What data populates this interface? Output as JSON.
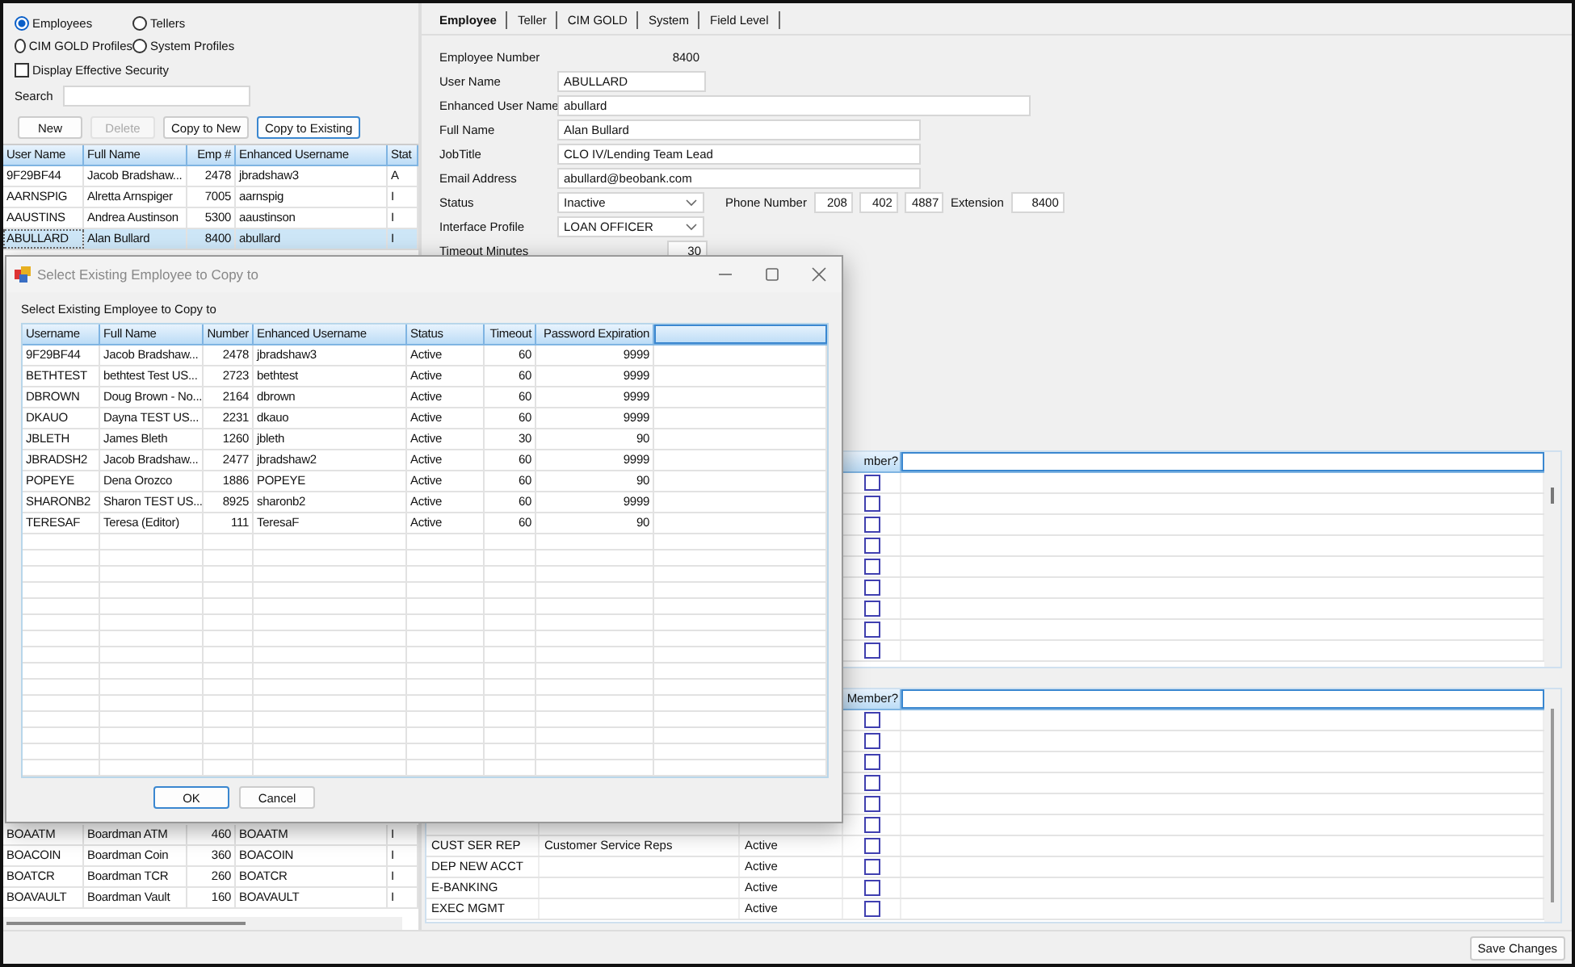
{
  "filter": {
    "options": [
      {
        "label": "Employees",
        "selected": true
      },
      {
        "label": "Tellers",
        "selected": false
      },
      {
        "label": "CIM GOLD Profiles",
        "selected": false
      },
      {
        "label": "System Profiles",
        "selected": false
      }
    ],
    "effective_security": {
      "label": "Display Effective Security",
      "checked": false
    }
  },
  "search": {
    "label": "Search"
  },
  "buttons": [
    {
      "label": "New",
      "disabled": false,
      "focused": false
    },
    {
      "label": "Delete",
      "disabled": true,
      "focused": false
    },
    {
      "label": "Copy to New",
      "disabled": false,
      "focused": false
    },
    {
      "label": "Copy to Existing",
      "disabled": false,
      "focused": true
    }
  ],
  "employee_table": {
    "columns": [
      {
        "label": "User Name",
        "numeric": false
      },
      {
        "label": "Full Name",
        "numeric": false
      },
      {
        "label": "Emp #",
        "numeric": true
      },
      {
        "label": "Enhanced Username",
        "numeric": false
      },
      {
        "label": "Stat",
        "numeric": false
      }
    ],
    "rows_top": [
      {
        "cells": [
          "9F29BF44",
          "Jacob Bradshaw...",
          "2478",
          "jbradshaw3",
          "A"
        ],
        "selected": false
      },
      {
        "cells": [
          "AARNSPIG",
          "Alretta Arnspiger",
          "7005",
          "aarnspig",
          "I"
        ],
        "selected": false
      },
      {
        "cells": [
          "AAUSTINS",
          "Andrea Austinson",
          "5300",
          "aaustinson",
          "I"
        ],
        "selected": false
      },
      {
        "cells": [
          "ABULLARD",
          "Alan Bullard",
          "8400",
          "abullard",
          "I"
        ],
        "selected": true
      }
    ],
    "rows_bottom": [
      {
        "cells": [
          "BOAATM",
          "Boardman ATM",
          "460",
          "BOAATM",
          "I"
        ],
        "selected": false
      },
      {
        "cells": [
          "BOACOIN",
          "Boardman Coin",
          "360",
          "BOACOIN",
          "I"
        ],
        "selected": false
      },
      {
        "cells": [
          "BOATCR",
          "Boardman TCR",
          "260",
          "BOATCR",
          "I"
        ],
        "selected": false
      },
      {
        "cells": [
          "BOAVAULT",
          "Boardman Vault",
          "160",
          "BOAVAULT",
          "I"
        ],
        "selected": false
      }
    ]
  },
  "tabs": [
    {
      "label": "Employee",
      "selected": true
    },
    {
      "label": "Teller",
      "selected": false
    },
    {
      "label": "CIM GOLD",
      "selected": false
    },
    {
      "label": "System",
      "selected": false
    },
    {
      "label": "Field Level",
      "selected": false
    }
  ],
  "form": {
    "employee_number": {
      "label": "Employee Number",
      "value": "8400"
    },
    "user_name": {
      "label": "User Name",
      "value": "ABULLARD"
    },
    "enhanced_user_name": {
      "label": "Enhanced User Name",
      "value": "abullard"
    },
    "full_name": {
      "label": "Full Name",
      "value": "Alan Bullard"
    },
    "job_title": {
      "label": "JobTitle",
      "value": "CLO IV/Lending Team Lead"
    },
    "email": {
      "label": "Email Address",
      "value": "abullard@beobank.com"
    },
    "status": {
      "label": "Status",
      "value": "Inactive"
    },
    "phone": {
      "label": "Phone Number",
      "parts": [
        "208",
        "402",
        "4887"
      ]
    },
    "extension": {
      "label": "Extension",
      "value": "8400"
    },
    "interface_profile": {
      "label": "Interface Profile",
      "value": "LOAN OFFICER"
    },
    "timeout": {
      "label": "Timeout Minutes",
      "value": "30"
    }
  },
  "group_grid_1": {
    "header": "mber?",
    "rows": [
      {
        "member": false
      },
      {
        "member": false
      },
      {
        "member": false
      },
      {
        "member": false
      },
      {
        "member": false
      },
      {
        "member": false
      },
      {
        "member": false
      },
      {
        "member": false
      },
      {
        "member": false
      }
    ]
  },
  "group_grid_2": {
    "header": "Member?",
    "rows": [
      {
        "member": false
      },
      {
        "member": false
      },
      {
        "member": false
      },
      {
        "member": false
      },
      {
        "member": false
      },
      {
        "member": false
      },
      {
        "member": false,
        "cells": [
          "CUST SER REP",
          "Customer Service Reps",
          "Active"
        ]
      },
      {
        "member": false,
        "cells": [
          "DEP NEW ACCT",
          "",
          "Active"
        ]
      },
      {
        "member": false,
        "cells": [
          "E-BANKING",
          "",
          "Active"
        ]
      },
      {
        "member": false,
        "cells": [
          "EXEC MGMT",
          "",
          "Active"
        ]
      }
    ]
  },
  "save_button": {
    "label": "Save Changes"
  },
  "dialog": {
    "title": "Select Existing Employee to Copy to",
    "label": "Select Existing Employee to Copy to",
    "columns": [
      {
        "label": "Username",
        "numeric": false
      },
      {
        "label": "Full Name",
        "numeric": false
      },
      {
        "label": "Number",
        "numeric": true
      },
      {
        "label": "Enhanced Username",
        "numeric": false
      },
      {
        "label": "Status",
        "numeric": false
      },
      {
        "label": "Timeout",
        "numeric": true
      },
      {
        "label": "Password Expiration",
        "numeric": true
      }
    ],
    "rows": [
      [
        "9F29BF44",
        "Jacob Bradshaw...",
        "2478",
        "jbradshaw3",
        "Active",
        "60",
        "9999"
      ],
      [
        "BETHTEST",
        "bethtest Test US...",
        "2723",
        "bethtest",
        "Active",
        "60",
        "9999"
      ],
      [
        "DBROWN",
        "Doug Brown - No...",
        "2164",
        "dbrown",
        "Active",
        "60",
        "9999"
      ],
      [
        "DKAUO",
        "Dayna TEST US...",
        "2231",
        "dkauo",
        "Active",
        "60",
        "9999"
      ],
      [
        "JBLETH",
        "James Bleth",
        "1260",
        "jbleth",
        "Active",
        "30",
        "90"
      ],
      [
        "JBRADSH2",
        "Jacob Bradshaw...",
        "2477",
        "jbradshaw2",
        "Active",
        "60",
        "9999"
      ],
      [
        "POPEYE",
        "Dena Orozco",
        "1886",
        "POPEYE",
        "Active",
        "60",
        "90"
      ],
      [
        "SHARONB2",
        "Sharon TEST US...",
        "8925",
        "sharonb2",
        "Active",
        "60",
        "9999"
      ],
      [
        "TERESAF",
        "Teresa (Editor)",
        "111",
        "TeresaF",
        "Active",
        "60",
        "90"
      ]
    ],
    "buttons": [
      {
        "label": "OK",
        "default": true
      },
      {
        "label": "Cancel",
        "default": false
      }
    ]
  }
}
